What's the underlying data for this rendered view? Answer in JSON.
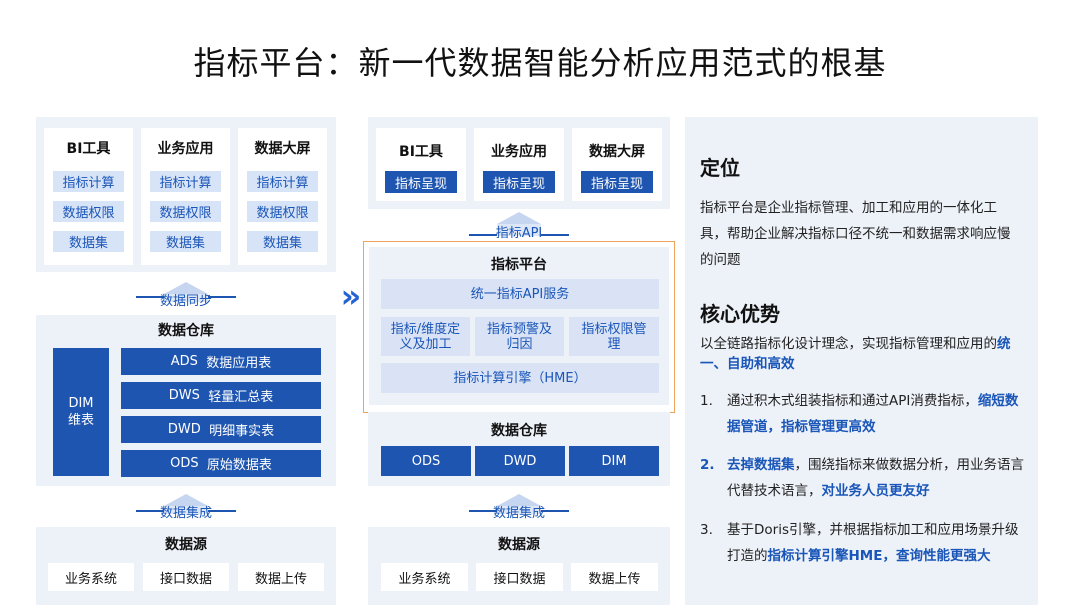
{
  "title": "指标平台：新一代数据智能分析应用范式的根基",
  "left": {
    "apps": [
      {
        "name": "BI工具",
        "items": [
          "指标计算",
          "数据权限",
          "数据集"
        ]
      },
      {
        "name": "业务应用",
        "items": [
          "指标计算",
          "数据权限",
          "数据集"
        ]
      },
      {
        "name": "数据大屏",
        "items": [
          "指标计算",
          "数据权限",
          "数据集"
        ]
      }
    ],
    "sync_label": "数据同步",
    "warehouse_title": "数据仓库",
    "dim_label": "DIM\n维表",
    "layers": [
      {
        "code": "ADS",
        "name": "数据应用表"
      },
      {
        "code": "DWS",
        "name": "轻量汇总表"
      },
      {
        "code": "DWD",
        "name": "明细事实表"
      },
      {
        "code": "ODS",
        "name": "原始数据表"
      }
    ],
    "integrate_label": "数据集成",
    "source_title": "数据源",
    "sources": [
      "业务系统",
      "接口数据",
      "数据上传"
    ]
  },
  "arrow_glyph": "»",
  "right": {
    "apps": [
      {
        "name": "BI工具",
        "item": "指标呈现"
      },
      {
        "name": "业务应用",
        "item": "指标呈现"
      },
      {
        "name": "数据大屏",
        "item": "指标呈现"
      }
    ],
    "api_label": "指标API",
    "platform_title": "指标平台",
    "api_service": "统一指标API服务",
    "features": [
      "指标/维度定义及加工",
      "指标预警及归因",
      "指标权限管理"
    ],
    "engine": "指标计算引擎（HME）",
    "warehouse_title": "数据仓库",
    "warehouse_items": [
      "ODS",
      "DWD",
      "DIM"
    ],
    "integrate_label": "数据集成",
    "source_title": "数据源",
    "sources": [
      "业务系统",
      "接口数据",
      "数据上传"
    ]
  },
  "side": {
    "position_title": "定位",
    "position_text": "指标平台是企业指标管理、加工和应用的一体化工具，帮助企业解决指标口径不统一和数据需求响应慢的问题",
    "advantage_title": "核心优势",
    "advantage_intro": "以全链路指标化设计理念，实现指标管理和应用的",
    "advantage_intro_hl": "统一、自助和高效",
    "points": [
      {
        "num": "1.",
        "text": "通过积木式组装指标和通过API消费指标，",
        "hl": "缩短数据管道，指标管理更高效"
      },
      {
        "num": "2.",
        "hl_lead": "去掉数据集",
        "text": "，围绕指标来做数据分析，用业务语言代替技术语言，",
        "hl": "对业务人员更友好"
      },
      {
        "num": "3.",
        "text": "基于Doris引擎，并根据指标加工和应用场景升级打造的",
        "hl": "指标计算引擎HME，查询性能更强大"
      }
    ]
  },
  "colors": {
    "accent": "#1e55b0",
    "light": "#d7e3f7",
    "panel": "#edf1f8",
    "orange": "#f0a35c"
  }
}
